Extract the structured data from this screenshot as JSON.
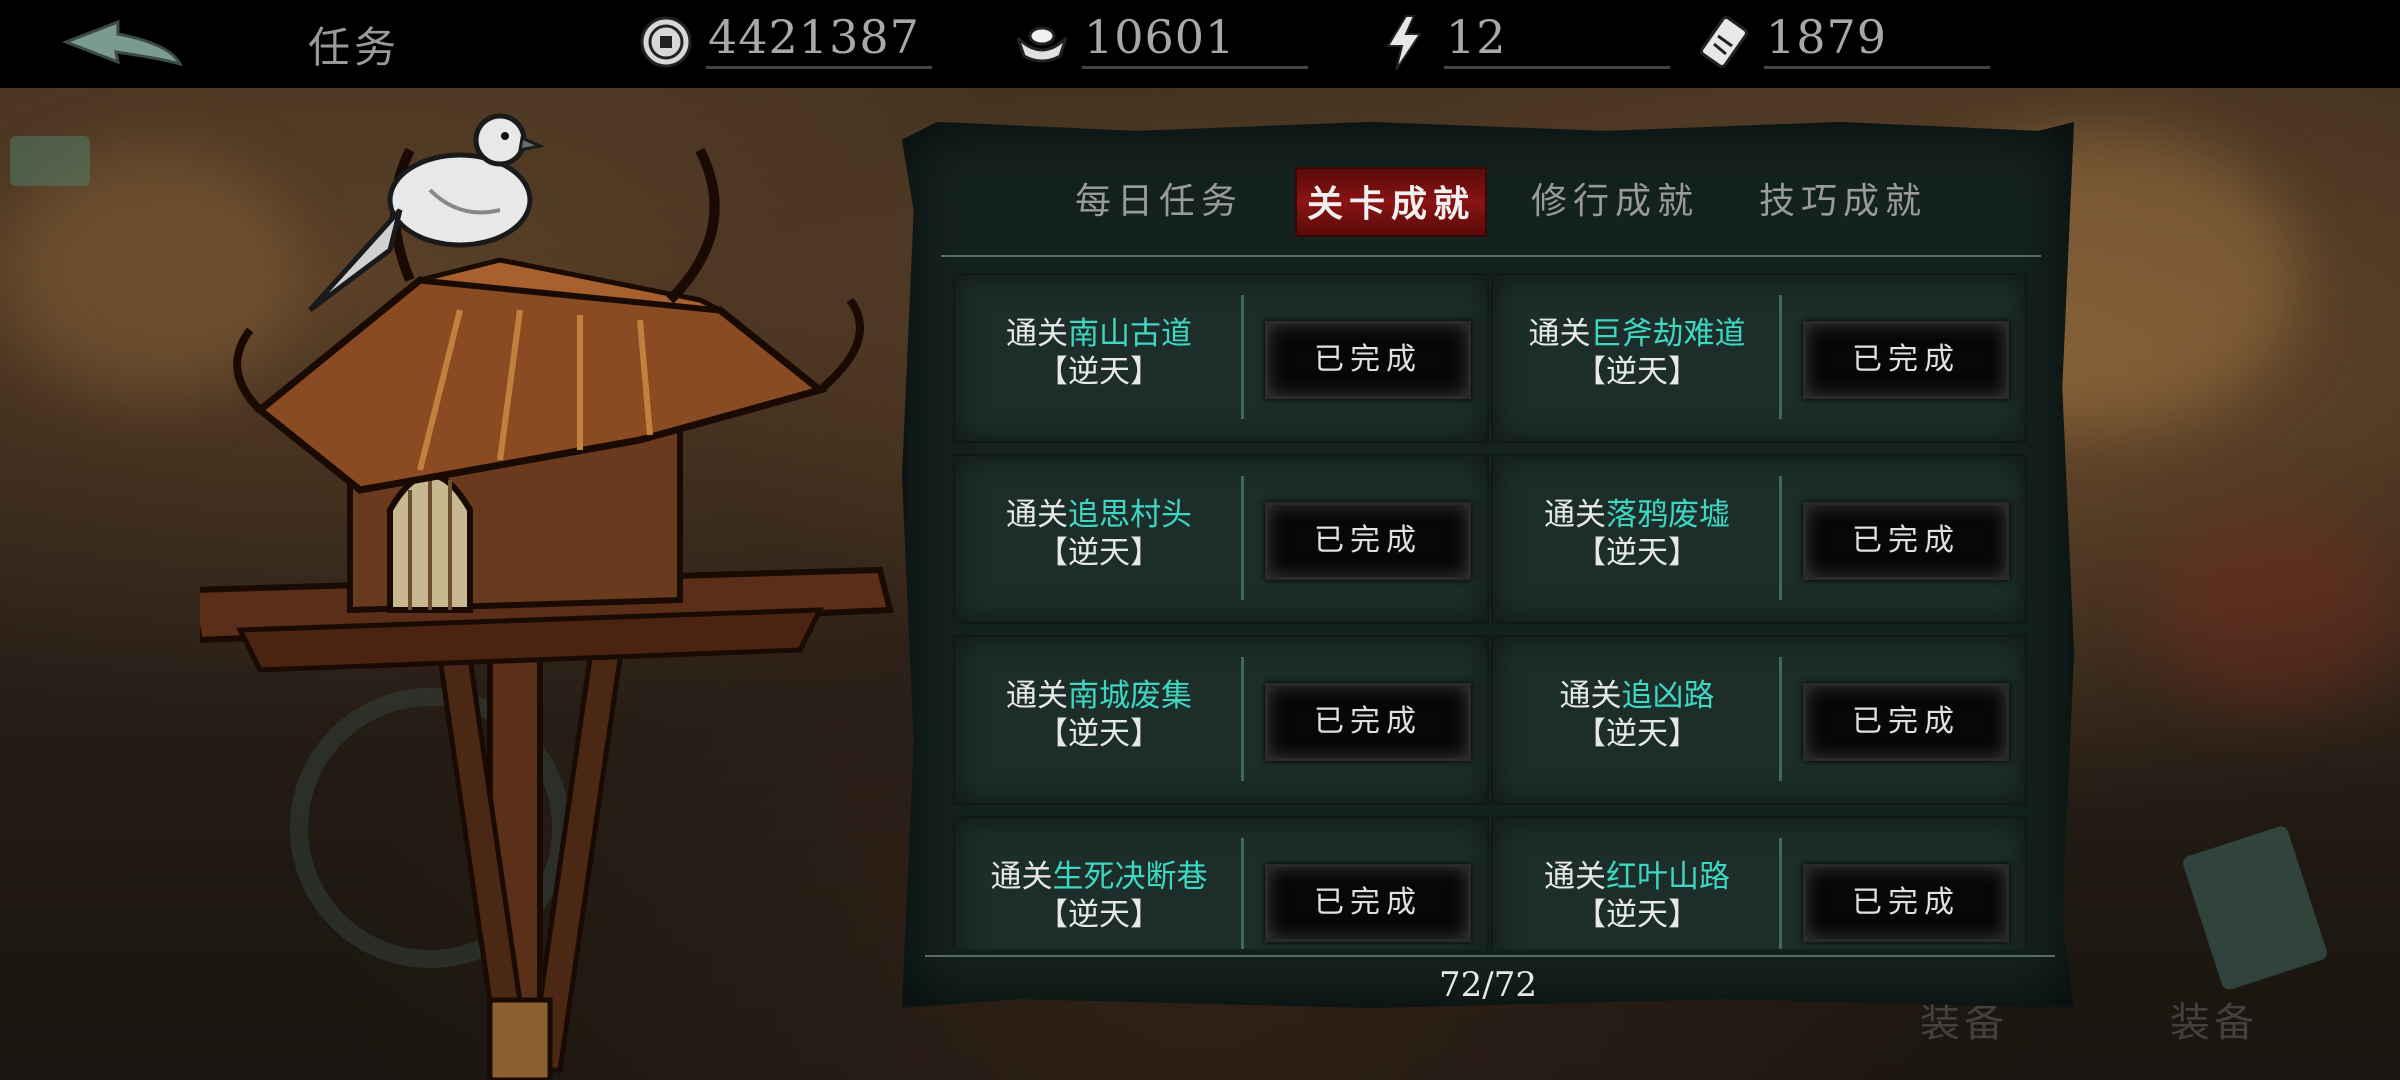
{
  "header": {
    "title": "任务",
    "currencies": [
      {
        "icon": "coin-icon",
        "value": "4421387"
      },
      {
        "icon": "silver-ingot-icon",
        "value": "10601"
      },
      {
        "icon": "lightning-icon",
        "value": "12"
      },
      {
        "icon": "ticket-icon",
        "value": "1879"
      }
    ]
  },
  "tabs": [
    {
      "label": "每日任务",
      "active": false
    },
    {
      "label": "关卡成就",
      "active": true
    },
    {
      "label": "修行成就",
      "active": false
    },
    {
      "label": "技巧成就",
      "active": false
    }
  ],
  "achievements": [
    {
      "prefix": "通关",
      "stage": "南山古道",
      "difficulty": "【逆天】",
      "status": "已完成"
    },
    {
      "prefix": "通关",
      "stage": "巨斧劫难道",
      "difficulty": "【逆天】",
      "status": "已完成"
    },
    {
      "prefix": "通关",
      "stage": "追思村头",
      "difficulty": "【逆天】",
      "status": "已完成"
    },
    {
      "prefix": "通关",
      "stage": "落鸦废墟",
      "difficulty": "【逆天】",
      "status": "已完成"
    },
    {
      "prefix": "通关",
      "stage": "南城废集",
      "difficulty": "【逆天】",
      "status": "已完成"
    },
    {
      "prefix": "通关",
      "stage": "追凶路",
      "difficulty": "【逆天】",
      "status": "已完成"
    },
    {
      "prefix": "通关",
      "stage": "生死决断巷",
      "difficulty": "【逆天】",
      "status": "已完成"
    },
    {
      "prefix": "通关",
      "stage": "红叶山路",
      "difficulty": "【逆天】",
      "status": "已完成"
    }
  ],
  "progress": {
    "text": "72/72",
    "completed": 72,
    "total": 72
  },
  "colors": {
    "stage_highlight": "#3fd6c2",
    "active_tab": "#8a1414",
    "panel_bg": "#14221f"
  }
}
